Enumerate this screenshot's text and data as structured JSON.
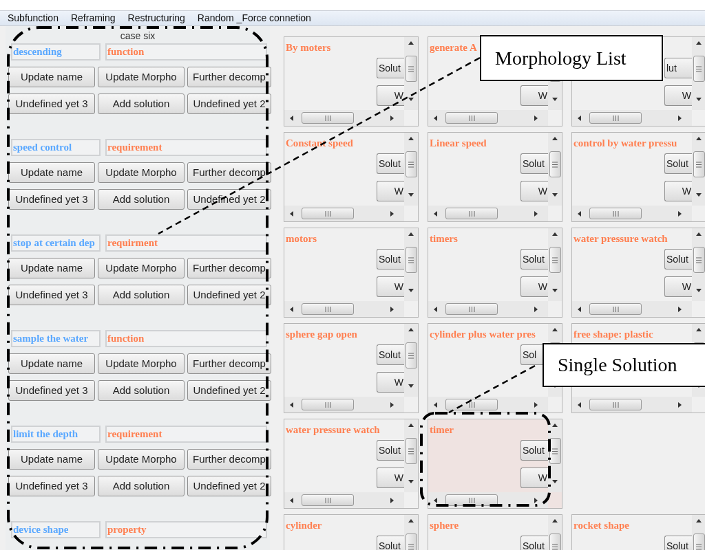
{
  "menu": [
    {
      "label": "Subfunction"
    },
    {
      "label": "Reframing"
    },
    {
      "label": "Restructuring"
    },
    {
      "label": "Random _Force connetion"
    }
  ],
  "panel": {
    "title": "case six",
    "groups": [
      {
        "name": "descending",
        "type": "function",
        "buttons": [
          "Update name",
          "Update Morpho",
          "Further decomp",
          "Undefined yet 3",
          "Add solution",
          "Undefined yet 2"
        ]
      },
      {
        "name": "speed control",
        "type": "requirement",
        "buttons": [
          "Update name",
          "Update Morpho",
          "Further decomp",
          "Undefined yet 3",
          "Add solution",
          "Undefined yet 2"
        ]
      },
      {
        "name": "stop at certain dep",
        "type": "requirment",
        "buttons": [
          "Update name",
          "Update Morpho",
          "Further decomp",
          "Undefined yet 3",
          "Add solution",
          "Undefined yet 2"
        ]
      },
      {
        "name": "sample the water",
        "type": "function",
        "buttons": [
          "Update name",
          "Update Morpho",
          "Further decomp",
          "Undefined yet 3",
          "Add solution",
          "Undefined yet 2"
        ]
      },
      {
        "name": "limit the depth",
        "type": "requirement",
        "buttons": [
          "Update name",
          "Update Morpho",
          "Further decomp",
          "Undefined yet 3",
          "Add solution",
          "Undefined yet 2"
        ]
      },
      {
        "name": "device shape",
        "type": "property"
      }
    ]
  },
  "cards": [
    {
      "kind": "card",
      "title": "By moters",
      "solution": "Solut",
      "w": "W",
      "selected": false
    },
    {
      "kind": "card",
      "title": "generate A",
      "w": "W",
      "selected": false
    },
    {
      "kind": "card",
      "solution": "lut",
      "w": "W",
      "selected": false
    },
    {
      "kind": "card",
      "title": "Constant speed",
      "solution": "Solut",
      "w": "W",
      "selected": false
    },
    {
      "kind": "card",
      "title": "Linear speed",
      "solution": "Solut",
      "w": "W",
      "selected": false
    },
    {
      "kind": "card",
      "title": "control by water pressu",
      "solution": "Solut",
      "w": "W",
      "selected": false
    },
    {
      "kind": "card",
      "title": "motors",
      "solution": "Solut",
      "w": "W",
      "selected": false
    },
    {
      "kind": "card",
      "title": "timers",
      "solution": "Solut",
      "w": "W",
      "selected": false
    },
    {
      "kind": "card",
      "title": "water pressure watch",
      "solution": "Solut",
      "w": "W",
      "selected": false
    },
    {
      "kind": "card",
      "title": "sphere gap open",
      "solution": "Solut",
      "w": "W",
      "selected": false
    },
    {
      "kind": "card",
      "title": "cylinder plus water pres",
      "solution": "Sol",
      "selected": false
    },
    {
      "kind": "card",
      "title": "free shape: plastic",
      "selected": false
    },
    {
      "kind": "card",
      "title": "water pressure watch",
      "solution": "Solut",
      "w": "W",
      "selected": false
    },
    {
      "kind": "card",
      "title": "timer",
      "solution": "Solut",
      "w": "W",
      "selected": true
    },
    {
      "kind": "empty"
    },
    {
      "kind": "card",
      "title": "cylinder",
      "solution": "Solut",
      "selected": false
    },
    {
      "kind": "card",
      "title": "sphere",
      "solution": "Solut",
      "selected": false
    },
    {
      "kind": "card",
      "title": "rocket shape",
      "solution": "Solut",
      "selected": false
    }
  ],
  "callouts": [
    {
      "text": "Morphology List"
    },
    {
      "text": "Single Solution"
    }
  ]
}
